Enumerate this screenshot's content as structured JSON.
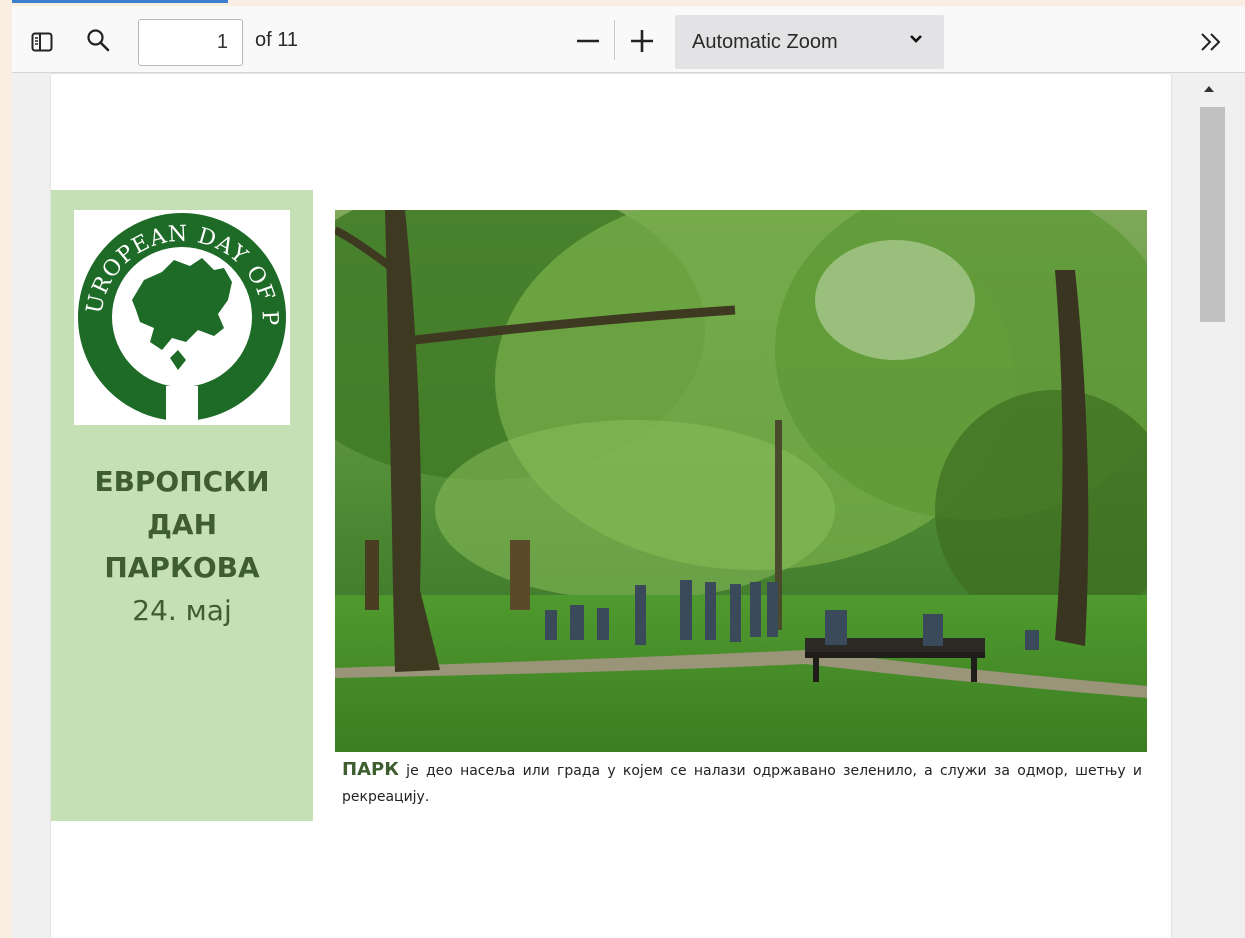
{
  "toolbar": {
    "sidebar_toggle_icon": "sidebar-toggle-icon",
    "search_icon": "search-icon",
    "page_number": "1",
    "page_count": "of 11",
    "zoom_out_icon": "minus-icon",
    "zoom_in_icon": "plus-icon",
    "zoom_value": "Automatic Zoom",
    "more_tools_icon": "double-chevron-right-icon"
  },
  "document": {
    "logo": {
      "text": "THE EUROPEAN DAY OF PARKS",
      "color": "#1e6b28"
    },
    "title_lines": [
      "ЕВРОПСКИ",
      "ДАН",
      "ПАРКОВА"
    ],
    "date": "24. мај",
    "caption_lead": "ПАРК",
    "caption_text": " је део насеља или града у којем се налази одржавано зеленило, а служи за одмор, шетњу и рекреацију."
  },
  "colors": {
    "sidebar_panel": "#c5e0b5",
    "title_text": "#3f5e2f",
    "logo_green": "#1e6b28"
  }
}
